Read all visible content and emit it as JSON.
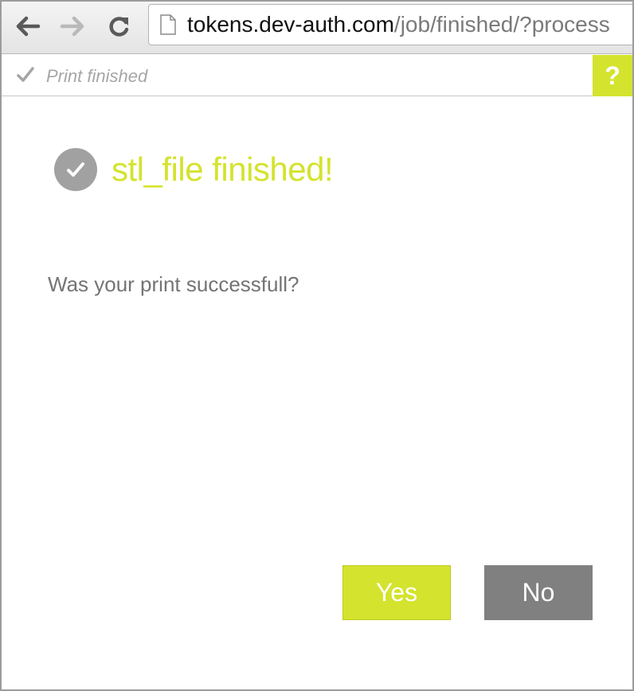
{
  "browser": {
    "url_host": "tokens.dev-auth.com",
    "url_path": "/job/finished/?process",
    "icons": [
      "back-arrow-icon",
      "forward-arrow-icon",
      "reload-icon",
      "page-icon"
    ]
  },
  "status_bar": {
    "text": "Print finished",
    "help_label": "?",
    "icon": "checkmark-icon"
  },
  "main": {
    "job_title": "stl_file finished!",
    "question": "Was your print successfull?",
    "yes_label": "Yes",
    "no_label": "No"
  },
  "colors": {
    "accent": "#d4e32d",
    "neutral_button": "#808080",
    "icon_gray": "#a1a1a1",
    "text_gray": "#747474"
  }
}
